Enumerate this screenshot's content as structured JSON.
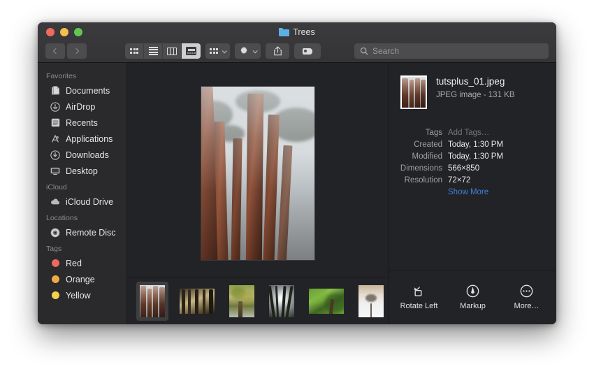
{
  "window": {
    "title": "Trees",
    "folder_icon": "folder-icon",
    "traffic_lights": [
      {
        "name": "close-button",
        "color": "#ED6A5E"
      },
      {
        "name": "minimize-button",
        "color": "#F5BE4F"
      },
      {
        "name": "zoom-button",
        "color": "#62C554"
      }
    ]
  },
  "toolbar": {
    "back_icon": "chevron-left-icon",
    "forward_icon": "chevron-right-icon",
    "view_modes": [
      {
        "name": "icon-view",
        "icon": "grid-icon",
        "active": false
      },
      {
        "name": "list-view",
        "icon": "list-icon",
        "active": false
      },
      {
        "name": "column-view",
        "icon": "columns-icon",
        "active": false
      },
      {
        "name": "gallery-view",
        "icon": "gallery-icon",
        "active": true
      }
    ],
    "group_icon": "group-items-icon",
    "action_icon": "gear-icon",
    "share_icon": "share-icon",
    "tag_icon": "tag-icon"
  },
  "search": {
    "placeholder": "Search",
    "value": "",
    "icon": "search-icon"
  },
  "sidebar": {
    "sections": [
      {
        "header": "Favorites",
        "items": [
          {
            "label": "Documents",
            "icon": "documents-icon"
          },
          {
            "label": "AirDrop",
            "icon": "airdrop-icon"
          },
          {
            "label": "Recents",
            "icon": "recents-icon"
          },
          {
            "label": "Applications",
            "icon": "applications-icon"
          },
          {
            "label": "Downloads",
            "icon": "downloads-icon"
          },
          {
            "label": "Desktop",
            "icon": "desktop-icon"
          }
        ]
      },
      {
        "header": "iCloud",
        "items": [
          {
            "label": "iCloud Drive",
            "icon": "icloud-drive-icon"
          }
        ]
      },
      {
        "header": "Locations",
        "items": [
          {
            "label": "Remote Disc",
            "icon": "remote-disc-icon"
          }
        ]
      },
      {
        "header": "Tags",
        "items": [
          {
            "label": "Red",
            "icon": "tag-dot-icon",
            "color": "#EC6A5E"
          },
          {
            "label": "Orange",
            "icon": "tag-dot-icon",
            "color": "#F0A847"
          },
          {
            "label": "Yellow",
            "icon": "tag-dot-icon",
            "color": "#F2D24B"
          }
        ]
      }
    ]
  },
  "preview": {
    "selected_index": 0,
    "thumbnails": [
      {
        "name": "thumb-redwoods-fog",
        "selected": true
      },
      {
        "name": "thumb-forest-path",
        "selected": false
      },
      {
        "name": "thumb-autumn-canopy",
        "selected": false
      },
      {
        "name": "thumb-sunburst-trees",
        "selected": false
      },
      {
        "name": "thumb-green-leaves",
        "selected": false
      },
      {
        "name": "thumb-lone-tree-snow",
        "selected": false
      },
      {
        "name": "thumb-partial",
        "selected": false
      }
    ]
  },
  "info": {
    "filename": "tutsplus_01.jpeg",
    "kind_size": "JPEG image - 131 KB",
    "rows": [
      {
        "key": "Tags",
        "value": "Add Tags…",
        "style": "placeholder"
      },
      {
        "key": "Created",
        "value": "Today, 1:30 PM",
        "style": "normal"
      },
      {
        "key": "Modified",
        "value": "Today, 1:30 PM",
        "style": "normal"
      },
      {
        "key": "Dimensions",
        "value": "566×850",
        "style": "normal"
      },
      {
        "key": "Resolution",
        "value": "72×72",
        "style": "normal"
      }
    ],
    "show_more": "Show More",
    "actions": [
      {
        "label": "Rotate Left",
        "icon": "rotate-left-icon"
      },
      {
        "label": "Markup",
        "icon": "markup-icon"
      },
      {
        "label": "More…",
        "icon": "more-ellipsis-icon"
      }
    ]
  },
  "colors": {
    "accent_link": "#3B82DA",
    "window_bg": "#222326",
    "sidebar_bg": "#2A2A2C",
    "toolbar_bg": "#3A3A3C"
  }
}
